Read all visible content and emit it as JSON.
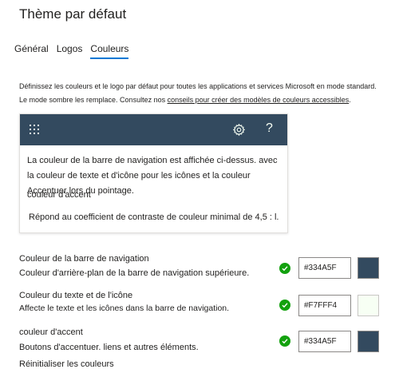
{
  "page": {
    "title": "Thème par défaut"
  },
  "tabs": [
    {
      "label": "Général",
      "active": false
    },
    {
      "label": "Logos",
      "active": false
    },
    {
      "label": "Couleurs",
      "active": true
    }
  ],
  "description": {
    "line1": "Définissez les couleurs et le logo par défaut pour toutes les applications et services Microsoft en mode standard.",
    "line2_pre": "Le mode sombre les remplace. Consultez nos ",
    "line2_link": "conseils pour créer des modèles de couleurs accessibles",
    "line2_post": "."
  },
  "preview": {
    "navbar_color": "#334A5F",
    "icon_color": "#F7FFF4",
    "icons": [
      "waffle-icon",
      "gear-icon",
      "help-icon"
    ],
    "help_glyph": "?",
    "text": "La couleur de la barre de navigation est affichée ci-dessus. avec la couleur de texte et d'icône pour les icônes et la couleur Accentuer lors du pointage.",
    "accent_label": "couleur d'accent",
    "contrast_note": "Répond au coefficient de contraste de couleur minimal de 4,5 : l."
  },
  "color_settings": [
    {
      "label": "Couleur de la barre de navigation",
      "description": "Couleur d'arrière-plan de la barre de navigation supérieure.",
      "value": "#334A5F",
      "swatch": "#334A5F",
      "valid": true
    },
    {
      "label": "Couleur du texte et de l'icône",
      "description": "Affecte le texte et les icônes dans la barre de navigation.",
      "value": "#F7FFF4",
      "swatch": "#F7FFF4",
      "valid": true
    },
    {
      "label": "couleur d'accent",
      "description": "Boutons d'accentuer. liens et autres éléments.",
      "value": "#334A5F",
      "swatch": "#334A5F",
      "valid": true
    }
  ],
  "reset_label": "Réinitialiser les couleurs",
  "colors": {
    "accent": "#0078D4",
    "success": "#13A10E"
  }
}
